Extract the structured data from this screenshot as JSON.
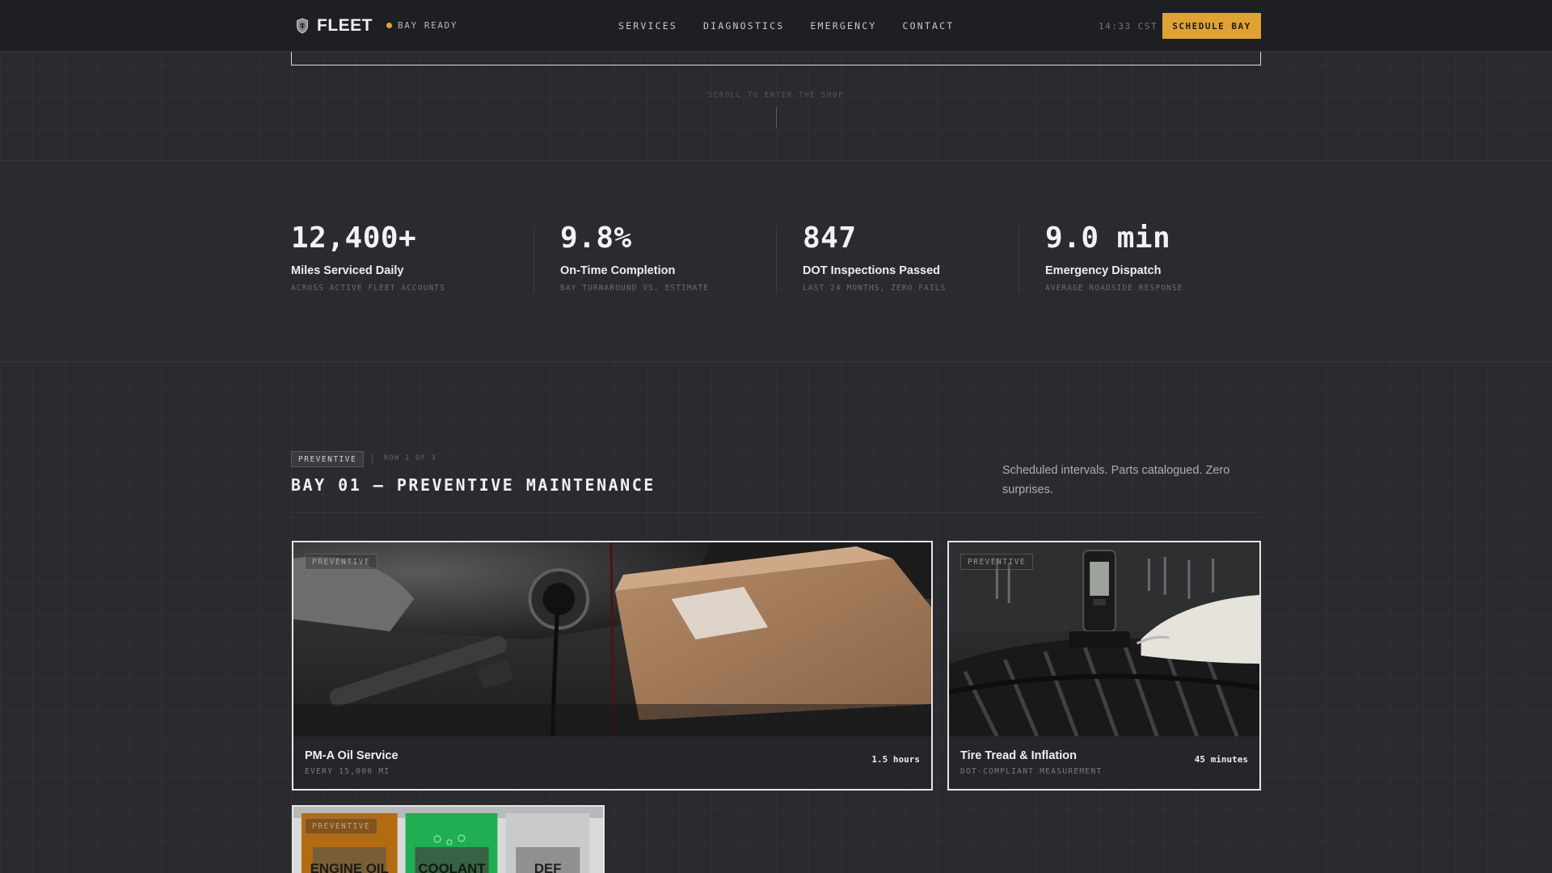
{
  "nav": {
    "brand": "FLEET",
    "status": "BAY READY",
    "links": [
      "SERVICES",
      "DIAGNOSTICS",
      "EMERGENCY",
      "CONTACT"
    ],
    "clock": "14:33 CST",
    "cta": "SCHEDULE BAY",
    "accent_color": "#dfa233"
  },
  "hero": {
    "scroll_hint": "SCROLL TO ENTER THE SHOP"
  },
  "stats": [
    {
      "value": "12,400+",
      "label": "Miles Serviced Daily",
      "sub": "ACROSS ACTIVE FLEET ACCOUNTS"
    },
    {
      "value": "9.8%",
      "label": "On-Time Completion",
      "sub": "BAY TURNAROUND VS. ESTIMATE"
    },
    {
      "value": "847",
      "label": "DOT Inspections Passed",
      "sub": "LAST 24 MONTHS, ZERO FAILS"
    },
    {
      "value": "9.0 min",
      "label": "Emergency Dispatch",
      "sub": "AVERAGE ROADSIDE RESPONSE"
    }
  ],
  "section": {
    "tag": "PREVENTIVE",
    "row_label": "ROW 1 OF 3",
    "title": "BAY 01 — PREVENTIVE MAINTENANCE",
    "description": "Scheduled intervals. Parts catalogued. Zero surprises."
  },
  "cards": [
    {
      "badge": "PREVENTIVE",
      "title": "PM-A Oil Service",
      "meta": "EVERY 15,000 MI",
      "duration": "1.5 hours",
      "image": "engine-oil-drain-photo"
    },
    {
      "badge": "PREVENTIVE",
      "title": "Tire Tread & Inflation",
      "meta": "DOT-COMPLIANT MEASUREMENT",
      "duration": "45 minutes",
      "image": "tire-tread-gauge-photo"
    },
    {
      "badge": "PREVENTIVE",
      "image": "fluid-bottles-photo",
      "bottle_labels": [
        "ENGINE OIL",
        "COOLANT",
        "DEF"
      ]
    }
  ]
}
